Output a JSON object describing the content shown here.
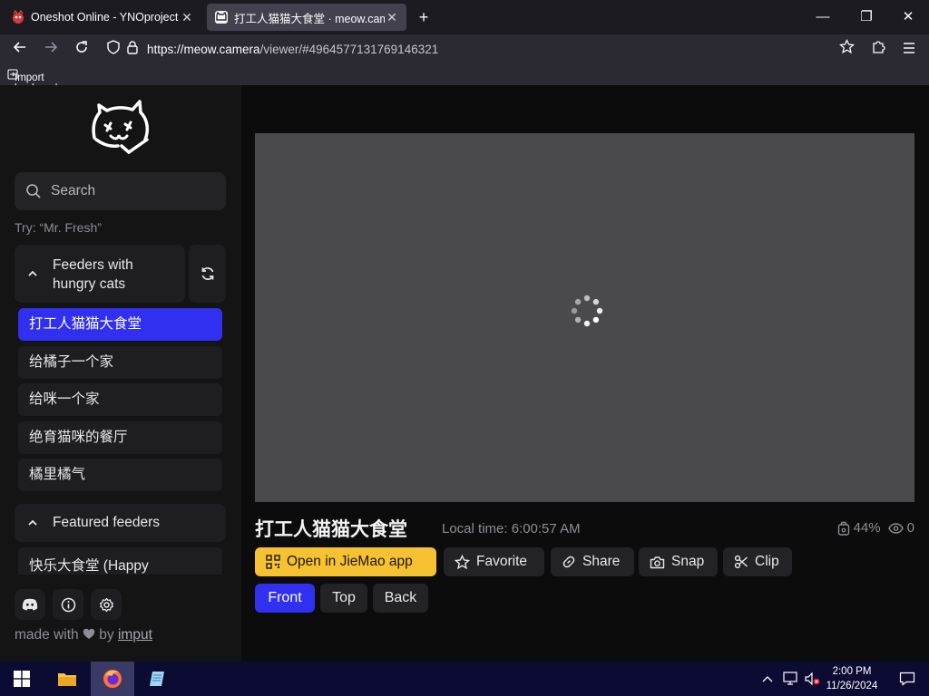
{
  "browser": {
    "tabs": [
      {
        "title": "Oneshot Online - YNOproject",
        "active": false
      },
      {
        "title": "打工人猫猫大食堂 · meow.cam",
        "active": true
      }
    ],
    "url_domain": "https://meow.camera",
    "url_path": "/viewer/#4964577131769146321",
    "bookmarks_label": "Import bookmarks..."
  },
  "sidebar": {
    "search_placeholder": "Search",
    "hint": "Try: “Mr. Fresh”",
    "group1_label": "Feeders with hungry cats",
    "feeders": [
      {
        "label": "打工人猫猫大食堂",
        "active": true
      },
      {
        "label": "给橘子一个家",
        "active": false
      },
      {
        "label": "给咪一个家",
        "active": false
      },
      {
        "label": "绝育猫咪的餐厅",
        "active": false
      },
      {
        "label": "橘里橘气",
        "active": false
      }
    ],
    "group2_label": "Featured feeders",
    "featured_first": "快乐大食堂 (Happy",
    "made_with_prefix": "made with",
    "made_with_by": "by",
    "made_with_author": "imput"
  },
  "viewer": {
    "title": "打工人猫猫大食堂",
    "local_time": "Local time: 6:00:57 AM",
    "battery": "44%",
    "viewers": "0",
    "actions": {
      "open_app": "Open in JieMao app",
      "favorite": "Favorite",
      "share": "Share",
      "snap": "Snap",
      "clip": "Clip"
    },
    "views": [
      {
        "label": "Front",
        "active": true
      },
      {
        "label": "Top",
        "active": false
      },
      {
        "label": "Back",
        "active": false
      }
    ]
  },
  "taskbar": {
    "time": "2:00 PM",
    "date": "11/26/2024"
  },
  "colors": {
    "accent_blue": "#3130f0",
    "accent_yellow": "#f6c232"
  }
}
